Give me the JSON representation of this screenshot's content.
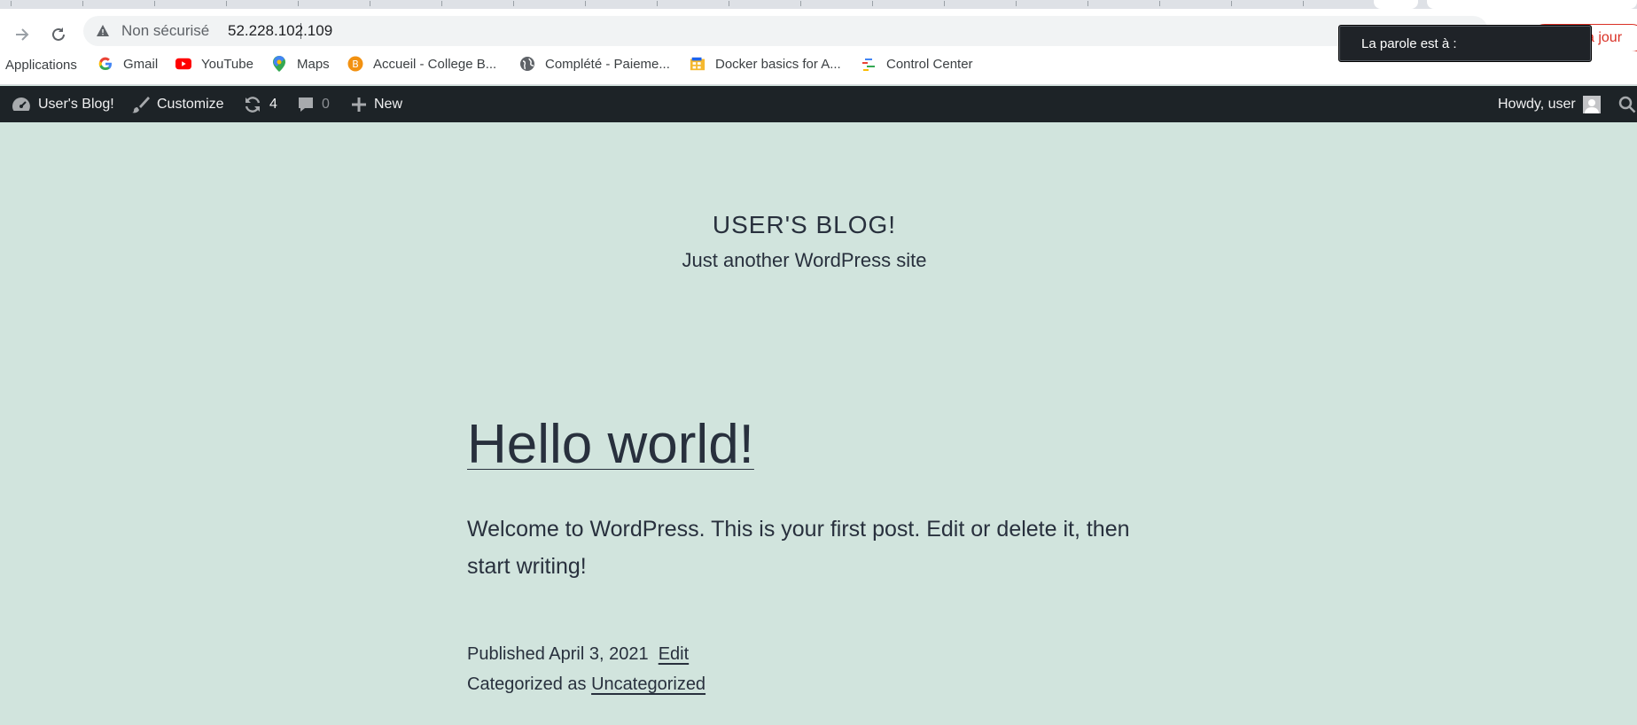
{
  "browser": {
    "security_label": "Non sécurisé",
    "url": "52.228.102.109",
    "update_label": "à jour",
    "speech_tooltip": "La parole est à :"
  },
  "bookmarks": [
    {
      "label": "Applications",
      "icon": "apps-icon"
    },
    {
      "label": "Gmail",
      "icon": "google-icon"
    },
    {
      "label": "YouTube",
      "icon": "youtube-icon"
    },
    {
      "label": "Maps",
      "icon": "maps-icon"
    },
    {
      "label": "Accueil - College B...",
      "icon": "college-icon"
    },
    {
      "label": "Complété - Paieme...",
      "icon": "globe-icon"
    },
    {
      "label": "Docker basics for A...",
      "icon": "docker-icon"
    },
    {
      "label": "Control Center",
      "icon": "control-center-icon"
    }
  ],
  "adminbar": {
    "site_name": "User's Blog!",
    "customize": "Customize",
    "updates_count": "4",
    "comments_count": "0",
    "new_label": "New",
    "howdy": "Howdy, user"
  },
  "site": {
    "title": "USER'S BLOG!",
    "description": "Just another WordPress site"
  },
  "post": {
    "title": "Hello world!",
    "body": "Welcome to WordPress. This is your first post. Edit or delete it, then start writing!",
    "published_prefix": "Published",
    "published_date": "April 3, 2021",
    "edit_label": "Edit",
    "categorized_prefix": "Categorized as",
    "category": "Uncategorized"
  },
  "colors": {
    "background": "#d1e4dd",
    "adminbar": "#1d2327",
    "text": "#28303d"
  }
}
